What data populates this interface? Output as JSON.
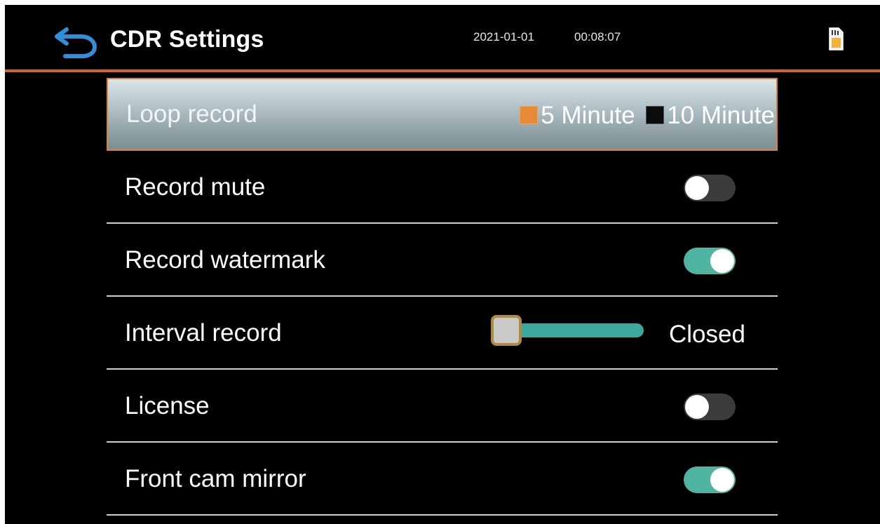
{
  "header": {
    "title": "CDR Settings",
    "date": "2021-01-01",
    "time": "00:08:07",
    "back_icon": "back-arrow-icon",
    "status_icon": "sd-card-icon"
  },
  "colors": {
    "accent_line": "#d2681f",
    "toggle_on": "#4fb5a2",
    "toggle_off": "#3b3b3b",
    "radio_selected": "#e88a35",
    "back_icon": "#2f8fd8"
  },
  "settings": [
    {
      "label": "Loop record",
      "type": "radio",
      "options": [
        "5 Minute",
        "10 Minute"
      ],
      "selected": "5 Minute",
      "highlighted": true
    },
    {
      "label": "Record mute",
      "type": "toggle",
      "on": false
    },
    {
      "label": "Record watermark",
      "type": "toggle",
      "on": true
    },
    {
      "label": "Interval record",
      "type": "slider",
      "value_text": "Closed",
      "level": 0
    },
    {
      "label": "License",
      "type": "toggle",
      "on": false
    },
    {
      "label": "Front cam mirror",
      "type": "toggle",
      "on": true
    }
  ]
}
